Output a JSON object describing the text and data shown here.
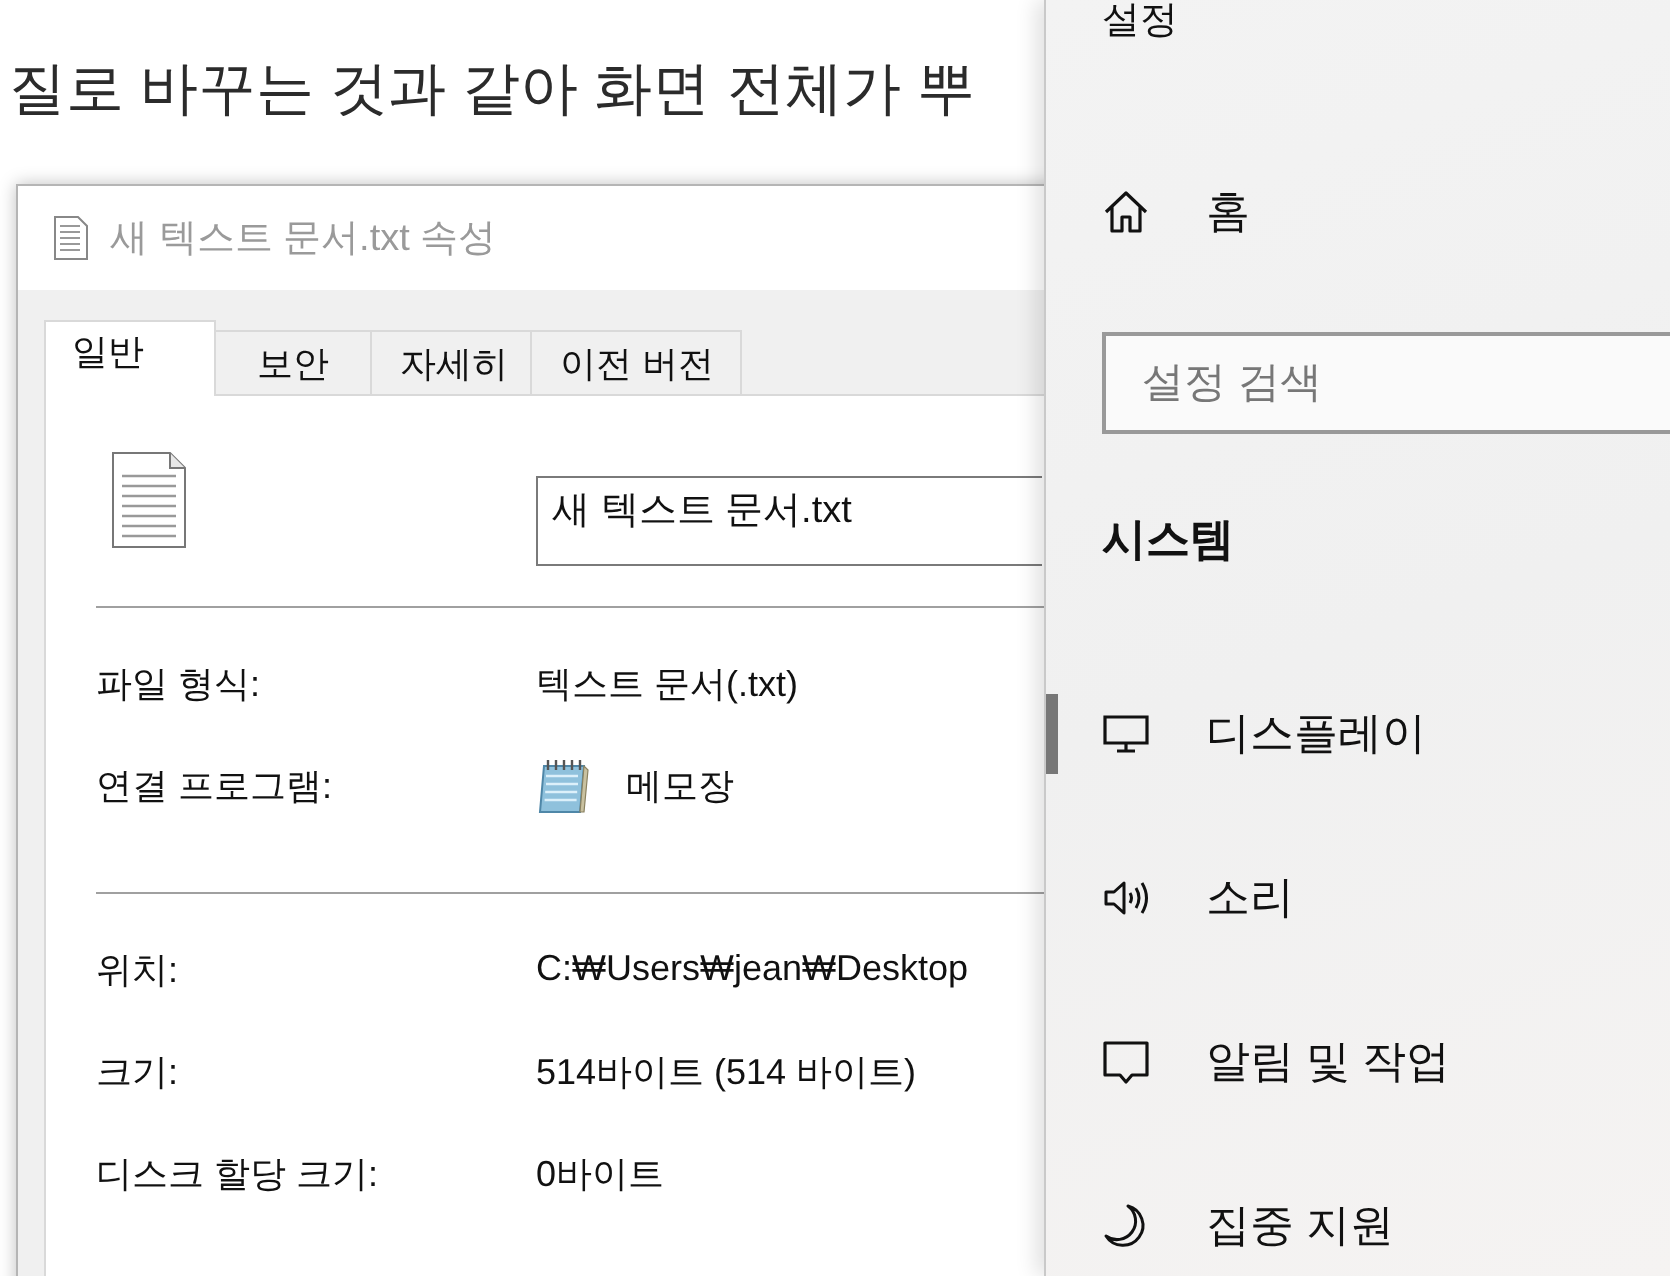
{
  "background_page": {
    "text_lines": [
      "질로 바꾸는 것과 같아 화면 전체가 뿌"
    ]
  },
  "properties_dialog": {
    "title": "새 텍스트 문서.txt 속성",
    "tabs": [
      {
        "label": "일반",
        "selected": true
      },
      {
        "label": "보안",
        "selected": false
      },
      {
        "label": "자세히",
        "selected": false
      },
      {
        "label": "이전 버전",
        "selected": false
      }
    ],
    "file_name": "새 텍스트 문서.txt",
    "sections": [
      {
        "rows": [
          {
            "kind": "text",
            "label": "파일 형식:",
            "value": "텍스트 문서(.txt)"
          },
          {
            "kind": "app",
            "label": "연결 프로그램:",
            "value": "메모장"
          }
        ]
      },
      {
        "rows": [
          {
            "kind": "text",
            "label": "위치:",
            "value": "C:₩Users₩jean₩Desktop"
          },
          {
            "kind": "text",
            "label": "크기:",
            "value": "514바이트 (514 바이트)"
          },
          {
            "kind": "text",
            "label": "디스크 할당 크기:",
            "value": "0바이트"
          }
        ]
      }
    ]
  },
  "settings": {
    "title": "설정",
    "home": "홈",
    "search": {
      "placeholder": "설정 검색"
    },
    "section_title": "시스템",
    "items": [
      {
        "label": "디스플레이",
        "selected": true
      },
      {
        "label": "소리",
        "selected": false
      },
      {
        "label": "알림 및 작업",
        "selected": false
      },
      {
        "label": "집중 지원",
        "selected": false
      }
    ]
  }
}
